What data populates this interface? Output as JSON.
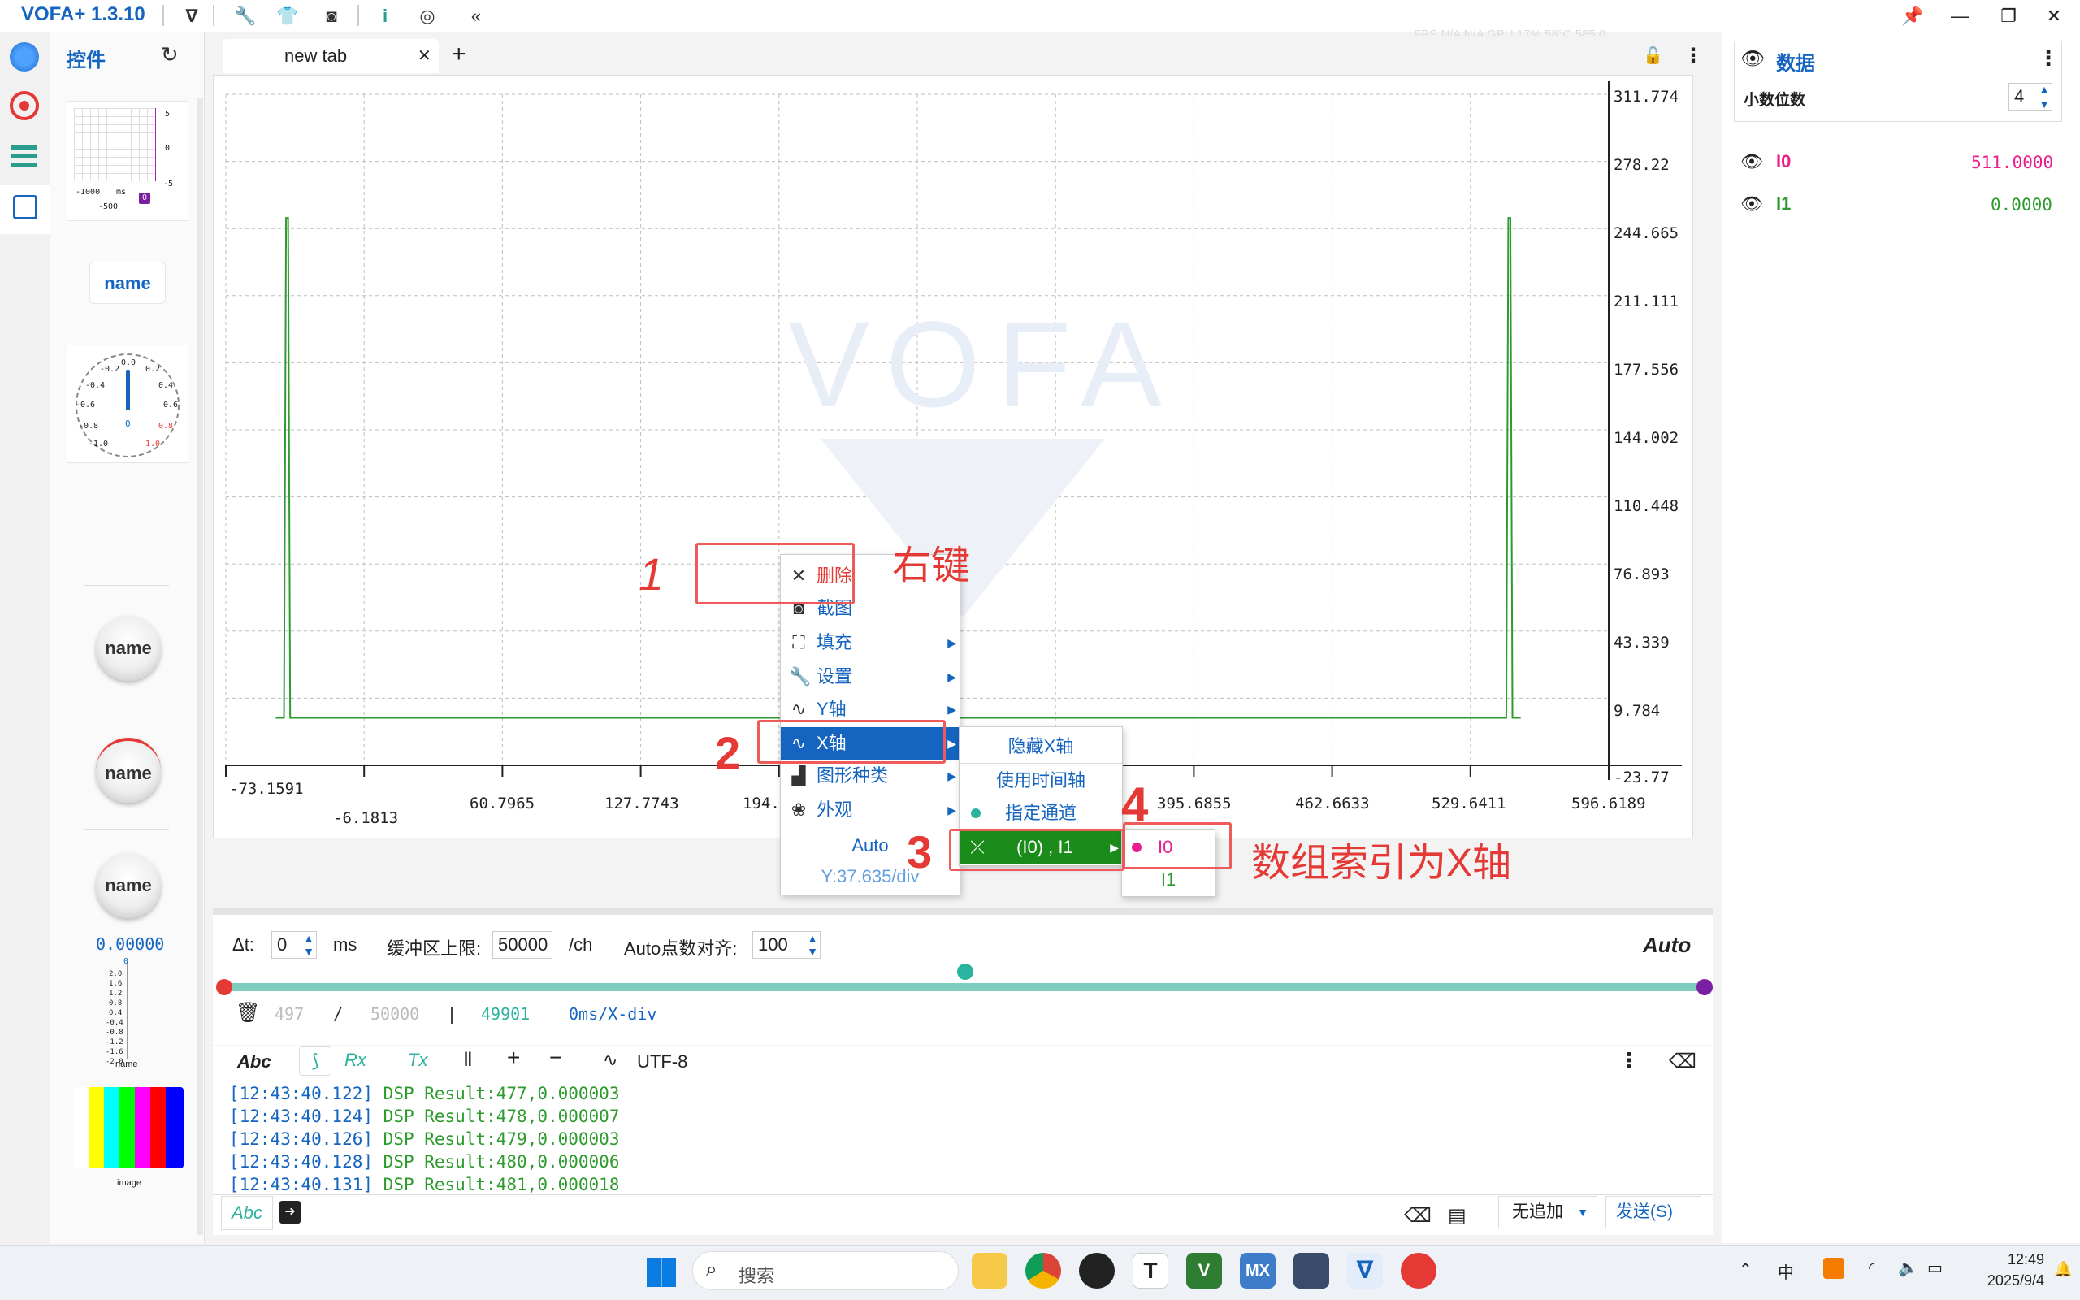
{
  "app": {
    "title": "VOFA+ 1.3.10"
  },
  "fps": {
    "label": "FPS",
    "v1": "N/A",
    "v2": "N/A",
    "gpu": "GPU",
    "gpu_val": "17% 58°C 585",
    "extra": "0"
  },
  "widgets": {
    "title": "控件",
    "mini_chart": {
      "y_ticks": [
        "5",
        "0",
        "-5"
      ],
      "x_ticks": [
        "-1000",
        "ms",
        "-500"
      ],
      "channel_badge": "0"
    },
    "name_card": "name",
    "gauge": {
      "labels": [
        "-0.2",
        "0.0",
        "0.2",
        "-0.4",
        "0.4",
        "-0.6",
        "0.6",
        "-0.8",
        "0.8",
        "-1.0",
        "1.0"
      ],
      "value": "0"
    },
    "knob1": "name",
    "knob2": "name",
    "knob3": "name",
    "knob_value": "0.00000",
    "slider_ticks": [
      "0",
      "2.0",
      "1.6",
      "1.2",
      "0.8",
      "0.4",
      "-0.4",
      "-0.8",
      "-1.2",
      "-1.6",
      "-2.0"
    ],
    "slider_label": "name",
    "image_label": "image"
  },
  "tab": {
    "label": "new tab"
  },
  "plot": {
    "y_labels": [
      "311.774",
      "278.22",
      "244.665",
      "211.111",
      "177.556",
      "144.002",
      "110.448",
      "76.893",
      "43.339",
      "9.784",
      "-23.77"
    ],
    "x_labels_low": [
      "-73.1591",
      "-6.1813"
    ],
    "x_labels": [
      "60.7965",
      "127.7743",
      "194.",
      "395.6855",
      "462.6633",
      "529.6411",
      "596.6189"
    ],
    "watermark": "VOFA"
  },
  "chart_data": {
    "type": "line",
    "title": "",
    "xlabel": "",
    "ylabel": "",
    "xlim": [
      -73.1591,
      596.6189
    ],
    "ylim": [
      -23.77,
      311.774
    ],
    "grid": true,
    "series": [
      {
        "color": "#2e9b2e",
        "x": [
          -49,
          -45,
          -44,
          -43,
          -42,
          547,
          548,
          549,
          550,
          554
        ],
        "y": [
          0,
          0,
          250,
          250,
          0,
          0,
          250,
          250,
          0,
          0
        ]
      }
    ]
  },
  "context_menu": {
    "items": [
      {
        "icon": "close-icon",
        "label": "删除"
      },
      {
        "icon": "screenshot-icon",
        "label": "截图"
      },
      {
        "icon": "fill-icon",
        "label": "填充"
      },
      {
        "icon": "wrench-icon",
        "label": "设置"
      },
      {
        "icon": "y-axis-icon",
        "label": "Y轴"
      },
      {
        "icon": "x-axis-icon",
        "label": "X轴"
      },
      {
        "icon": "chart-type-icon",
        "label": "图形种类"
      },
      {
        "icon": "palette-icon",
        "label": "外观"
      }
    ],
    "auto": "Auto",
    "div": "Y:37.635/div",
    "sub_xaxis": [
      "隐藏X轴",
      "使用时间轴",
      "指定通道",
      "(I0) , I1"
    ],
    "sub_channels": [
      "I0",
      "I1"
    ]
  },
  "annotations": {
    "n1": "1",
    "n2": "2",
    "n3": "3",
    "n4": "4",
    "right_click": "右键",
    "index_xaxis": "数组索引为X轴"
  },
  "data_panel": {
    "title": "数据",
    "decimals_label": "小数位数",
    "decimals_value": "4",
    "channels": [
      {
        "name": "I0",
        "value": "511.0000",
        "color": "#e91e8c"
      },
      {
        "name": "I1",
        "value": "0.0000",
        "color": "#2e9b2e"
      }
    ]
  },
  "controls": {
    "dt_label": "Δt:",
    "dt_value": "0",
    "dt_unit": "ms",
    "buffer_label": "缓冲区上限:",
    "buffer_value": "50000",
    "buffer_unit": "/ch",
    "auto_align_label": "Auto点数对齐:",
    "auto_align_value": "100",
    "auto": "Auto",
    "stat_a": "497",
    "stat_sep": "/",
    "stat_b": "50000",
    "stat_bar": "|",
    "stat_c": "49901",
    "stat_d": "0ms/X-div"
  },
  "console_toolbar": {
    "abc": "Abc",
    "rx": "Rx",
    "tx": "Tx",
    "encoding": "UTF-8"
  },
  "console_lines": [
    {
      "ts": "[12:43:40.122]",
      "text": "DSP Result:477,0.000003"
    },
    {
      "ts": "[12:43:40.124]",
      "text": "DSP Result:478,0.000007"
    },
    {
      "ts": "[12:43:40.126]",
      "text": "DSP Result:479,0.000003"
    },
    {
      "ts": "[12:43:40.128]",
      "text": "DSP Result:480,0.000006"
    },
    {
      "ts": "[12:43:40.131]",
      "text": "DSP Result:481,0.000018"
    }
  ],
  "send": {
    "abc": "Abc",
    "append": "无追加",
    "send_label": "发送(S)"
  },
  "taskbar": {
    "search": "搜索",
    "ime": "中",
    "time": "12:49",
    "date": "2025/9/4"
  }
}
